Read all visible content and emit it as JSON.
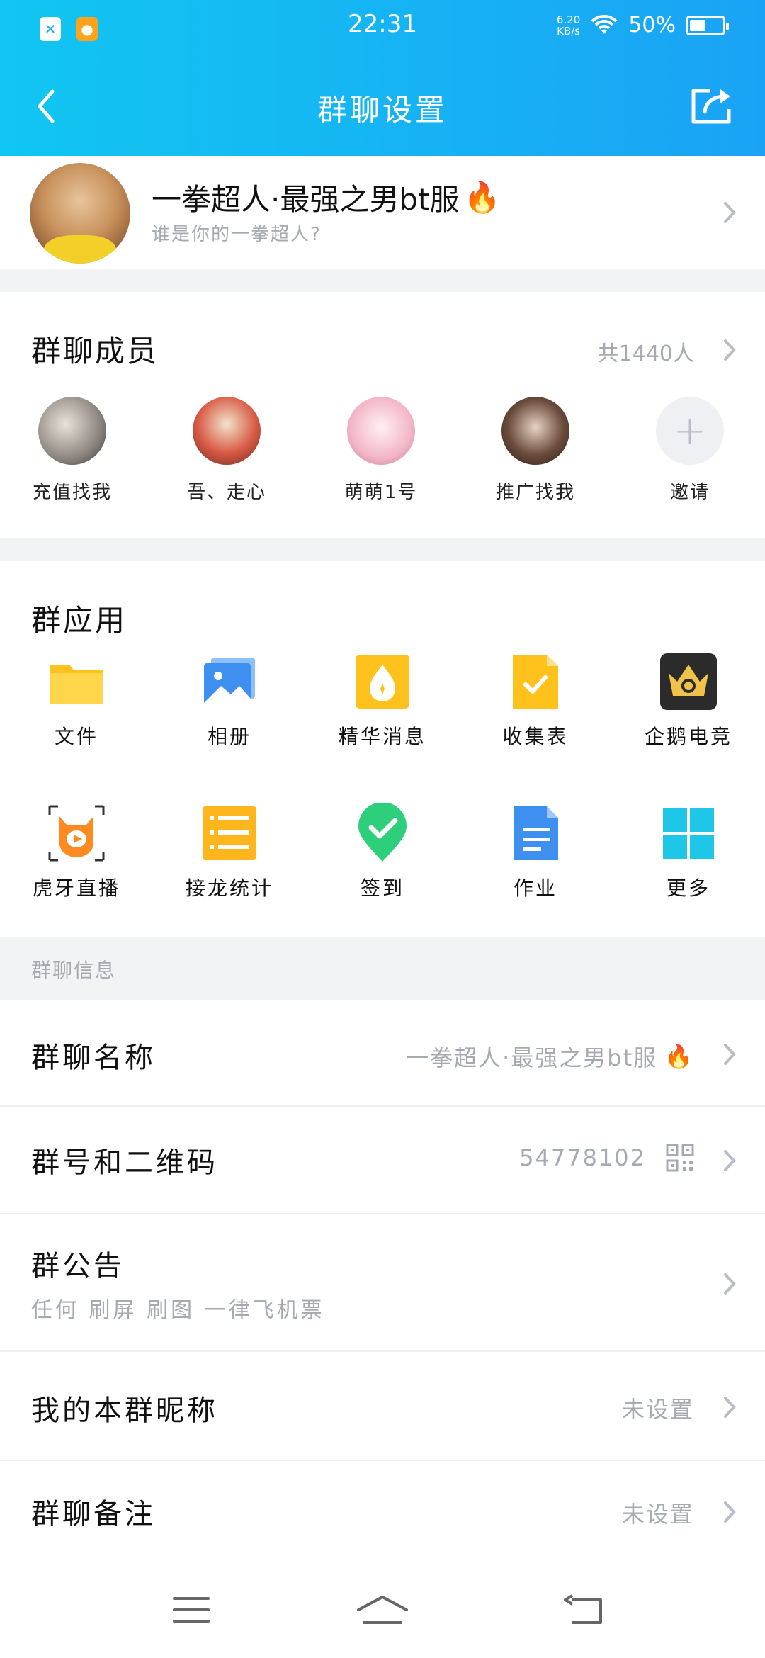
{
  "status_bar": {
    "time": "22:31",
    "net_speed_value": "6.20",
    "net_speed_unit": "KB/s",
    "battery_percent": "50%",
    "battery_level": 0.5
  },
  "nav": {
    "title": "群聊设置"
  },
  "group": {
    "name": "一拳超人·最强之男bt服",
    "name_emoji": "🔥",
    "subtitle": "谁是你的一拳超人?"
  },
  "members": {
    "title": "群聊成员",
    "count_label": "共1440人",
    "items": [
      {
        "label": "充值找我"
      },
      {
        "label": "吾、走心"
      },
      {
        "label": "萌萌1号"
      },
      {
        "label": "推广找我"
      },
      {
        "label": "邀请"
      }
    ]
  },
  "apps": {
    "title": "群应用",
    "items": [
      {
        "label": "文件",
        "icon": "folder-icon",
        "color": "#ffc21c"
      },
      {
        "label": "相册",
        "icon": "photo-album-icon",
        "color": "#3d8ff0"
      },
      {
        "label": "精华消息",
        "icon": "essence-message-icon",
        "color": "#ffc21c"
      },
      {
        "label": "收集表",
        "icon": "collection-form-icon",
        "color": "#ffc21c"
      },
      {
        "label": "企鹅电竞",
        "icon": "penguin-esports-icon",
        "color": "#2b2b2b"
      },
      {
        "label": "虎牙直播",
        "icon": "huya-live-icon",
        "color": "#ff8a1f"
      },
      {
        "label": "接龙统计",
        "icon": "relay-stats-icon",
        "color": "#ffb51c"
      },
      {
        "label": "签到",
        "icon": "check-in-icon",
        "color": "#2ecf7b"
      },
      {
        "label": "作业",
        "icon": "homework-icon",
        "color": "#3d8ff0"
      },
      {
        "label": "更多",
        "icon": "more-grid-icon",
        "color": "#1ec6e8"
      }
    ]
  },
  "info": {
    "section_label": "群聊信息",
    "group_name_label": "群聊名称",
    "group_name_value": "一拳超人·最强之男bt服",
    "group_name_emoji": "🔥",
    "group_number_label": "群号和二维码",
    "group_number_value": "54778102",
    "announcement_label": "群公告",
    "announcement_text": "任何 刷屏 刷图 一律飞机票",
    "nickname_label": "我的本群昵称",
    "nickname_value": "未设置",
    "remark_label": "群聊备注",
    "remark_value": "未设置"
  },
  "colors": {
    "header_start": "#11c6f2",
    "header_end": "#1aa3f5",
    "muted_text": "#a5a9b0",
    "section_bg": "#f2f3f5"
  }
}
